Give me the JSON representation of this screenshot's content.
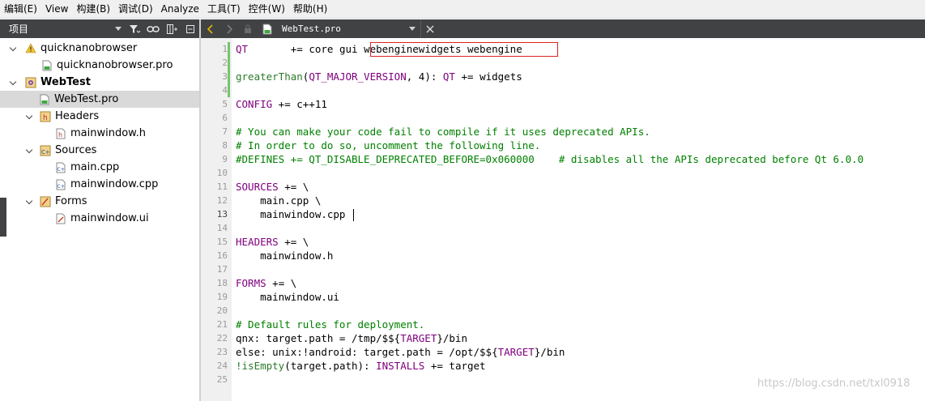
{
  "menu": [
    "编辑(E)",
    "View",
    "构建(B)",
    "调试(D)",
    "Analyze",
    "工具(T)",
    "控件(W)",
    "帮助(H)"
  ],
  "left_toolbar": {
    "combo_label": "项目"
  },
  "tree": {
    "items": [
      {
        "label": "quicknanobrowser"
      },
      {
        "label": "quicknanobrowser.pro"
      },
      {
        "label": "WebTest"
      },
      {
        "label": "WebTest.pro"
      },
      {
        "label": "Headers"
      },
      {
        "label": "mainwindow.h"
      },
      {
        "label": "Sources"
      },
      {
        "label": "main.cpp"
      },
      {
        "label": "mainwindow.cpp"
      },
      {
        "label": "Forms"
      },
      {
        "label": "mainwindow.ui"
      }
    ]
  },
  "editor": {
    "document": "WebTest.pro",
    "current_line": 13,
    "line_numbers": [
      "1",
      "2",
      "3",
      "4",
      "5",
      "6",
      "7",
      "8",
      "9",
      "10",
      "11",
      "12",
      "13",
      "14",
      "15",
      "16",
      "17",
      "18",
      "19",
      "20",
      "21",
      "22",
      "23",
      "24",
      "25"
    ],
    "lines": [
      [
        {
          "t": "QT",
          "c": "kw"
        },
        {
          "t": "       += core gui "
        },
        {
          "t": "webenginewidgets webengine"
        }
      ],
      [],
      [
        {
          "t": "greaterThan",
          "c": "fn"
        },
        {
          "t": "("
        },
        {
          "t": "QT_MAJOR_VERSION",
          "c": "kw"
        },
        {
          "t": ", 4): "
        },
        {
          "t": "QT",
          "c": "kw"
        },
        {
          "t": " += widgets"
        }
      ],
      [],
      [
        {
          "t": "CONFIG",
          "c": "kw"
        },
        {
          "t": " += c++11"
        }
      ],
      [],
      [
        {
          "t": "# You can make your code fail to compile if it uses deprecated APIs.",
          "c": "cmt"
        }
      ],
      [
        {
          "t": "# In order to do so, uncomment the following line.",
          "c": "cmt"
        }
      ],
      [
        {
          "t": "#DEFINES += QT_DISABLE_DEPRECATED_BEFORE=0x060000    # disables all the APIs deprecated before Qt 6.0.0",
          "c": "cmt"
        }
      ],
      [],
      [
        {
          "t": "SOURCES",
          "c": "kw"
        },
        {
          "t": " += \\"
        }
      ],
      [
        {
          "t": "    main.cpp \\"
        }
      ],
      [
        {
          "t": "    mainwindow.cpp"
        }
      ],
      [],
      [
        {
          "t": "HEADERS",
          "c": "kw"
        },
        {
          "t": " += \\"
        }
      ],
      [
        {
          "t": "    mainwindow.h"
        }
      ],
      [],
      [
        {
          "t": "FORMS",
          "c": "kw"
        },
        {
          "t": " += \\"
        }
      ],
      [
        {
          "t": "    mainwindow.ui"
        }
      ],
      [],
      [
        {
          "t": "# Default rules for deployment.",
          "c": "cmt"
        }
      ],
      [
        {
          "t": "qnx: target.path = /tmp/$${"
        },
        {
          "t": "TARGET",
          "c": "kw"
        },
        {
          "t": "}/bin"
        }
      ],
      [
        {
          "t": "else: unix:!android: target.path = /opt/$${"
        },
        {
          "t": "TARGET",
          "c": "kw"
        },
        {
          "t": "}/bin"
        }
      ],
      [
        {
          "t": "!isEmpty",
          "c": "fn"
        },
        {
          "t": "(target.path): "
        },
        {
          "t": "INSTALLS",
          "c": "kw"
        },
        {
          "t": " += target"
        }
      ],
      []
    ]
  },
  "watermark": "https://blog.csdn.net/txl0918"
}
